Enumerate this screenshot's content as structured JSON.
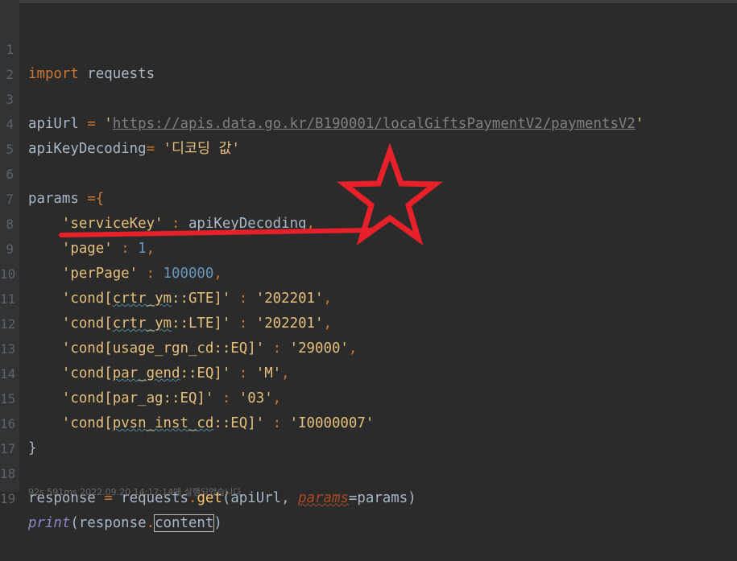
{
  "editor": {
    "line_numbers": [
      "1",
      "2",
      "3",
      "4",
      "5",
      "6",
      "7",
      "8",
      "9",
      "10",
      "11",
      "12",
      "13",
      "14",
      "15",
      "16",
      "17",
      "18",
      "19"
    ],
    "lines": {
      "l1": {
        "kw": "import",
        "rest": " requests"
      },
      "l3": {
        "name": "apiUrl",
        "op": " = ",
        "q1": "'",
        "url": "https://apis.data.go.kr/B190001/localGiftsPaymentV2/paymentsV2",
        "q2": "'"
      },
      "l4": {
        "name": "apiKeyDecoding",
        "op": "= ",
        "str": "'디코딩 값'"
      },
      "l6": {
        "name": "params",
        "op": " ={"
      },
      "l7": {
        "key": "'serviceKey'",
        "sep": " : ",
        "val": "apiKeyDecoding",
        "comma": ","
      },
      "l8": {
        "key": "'page'",
        "sep": " : ",
        "val": "1",
        "comma": ","
      },
      "l9": {
        "key": "'perPage'",
        "sep": " : ",
        "val": "100000",
        "comma": ","
      },
      "l10": {
        "k1": "'cond[",
        "k2": "crtr_ym",
        "k3": "::GTE]'",
        "sep": " : ",
        "val": "'202201'",
        "comma": ","
      },
      "l11": {
        "k1": "'cond[",
        "k2": "crtr_ym",
        "k3": "::LTE]'",
        "sep": " : ",
        "val": "'202201'",
        "comma": ","
      },
      "l12": {
        "key": "'cond[usage_rgn_cd::EQ]'",
        "sep": " : ",
        "val": "'29000'",
        "comma": ","
      },
      "l13": {
        "k1": "'cond[",
        "k2": "par_gend",
        "k3": "::EQ]'",
        "sep": " : ",
        "val": "'M'",
        "comma": ","
      },
      "l14": {
        "key": "'cond[par_ag::EQ]'",
        "sep": " : ",
        "val": "'03'",
        "comma": ","
      },
      "l15": {
        "k1": "'cond[",
        "k2": "pvsn_inst_cd",
        "k3": "::EQ]'",
        "sep": " : ",
        "val": "'I0000007'"
      },
      "l16": {
        "text": "}"
      },
      "l18": {
        "name": "response",
        "op": " = ",
        "obj": "requests",
        "dot": ".",
        "fn": "get",
        "p1": "(apiUrl, ",
        "param": "params",
        "p2": "=params)"
      },
      "l19": {
        "fn": "print",
        "p1": "(response",
        "dot": ".",
        "attr": "content",
        "p2": ")"
      }
    },
    "status_hint": "92s 591ms 2022.09.20 14:17:14에 실행되었습니다"
  },
  "annotation": {
    "color": "#e8202a",
    "shapes": [
      "star",
      "underline"
    ]
  }
}
